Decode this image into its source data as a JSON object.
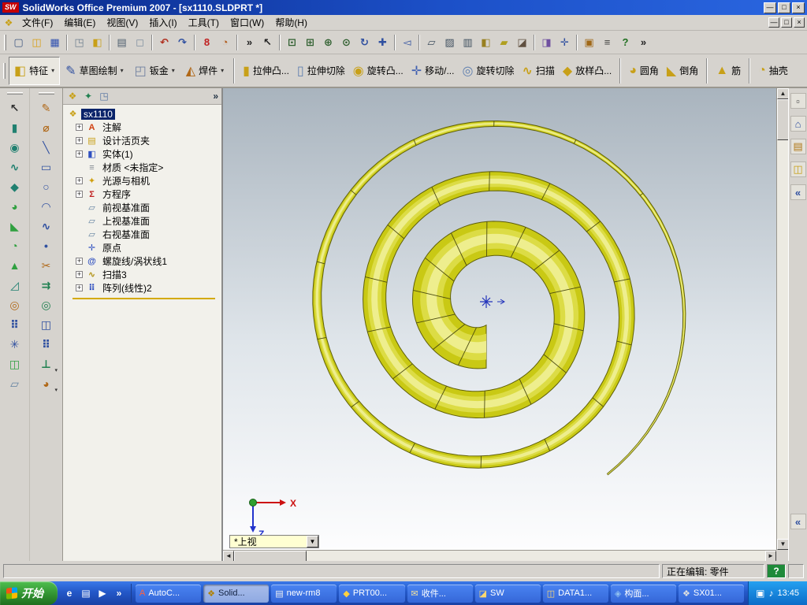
{
  "window": {
    "title": "SolidWorks Office Premium 2007 - [sx1110.SLDPRT *]",
    "logo_text": "SW",
    "controls": {
      "minimize": "—",
      "restore": "□",
      "close": "×"
    }
  },
  "menu_bar": {
    "doc_icon": {
      "name": "document-icon",
      "glyph": "❖",
      "color": "#c8a018"
    },
    "items": [
      {
        "name": "menu-file",
        "label": "文件(F)"
      },
      {
        "name": "menu-edit",
        "label": "编辑(E)"
      },
      {
        "name": "menu-view",
        "label": "视图(V)"
      },
      {
        "name": "menu-insert",
        "label": "插入(I)"
      },
      {
        "name": "menu-tools",
        "label": "工具(T)"
      },
      {
        "name": "menu-window",
        "label": "窗口(W)"
      },
      {
        "name": "menu-help",
        "label": "帮助(H)"
      }
    ],
    "controls": {
      "minimize": "—",
      "restore": "□",
      "close": "×"
    }
  },
  "standard_toolbar": {
    "icons": [
      {
        "name": "new-icon",
        "glyph": "▢",
        "color": "#405880"
      },
      {
        "name": "open-icon",
        "glyph": "◫",
        "color": "#d8a018"
      },
      {
        "name": "save-icon",
        "glyph": "▦",
        "color": "#3050b0"
      },
      {
        "sep": true
      },
      {
        "name": "make-drawing-icon",
        "glyph": "◳",
        "color": "#708090"
      },
      {
        "name": "make-assembly-icon",
        "glyph": "◧",
        "color": "#c8a018"
      },
      {
        "sep": true
      },
      {
        "name": "print-icon",
        "glyph": "▤",
        "color": "#506070"
      },
      {
        "name": "print-preview-icon",
        "glyph": "◻",
        "color": "#8090a0"
      },
      {
        "sep": true
      },
      {
        "name": "undo-icon",
        "glyph": "↶",
        "color": "#b03020"
      },
      {
        "name": "redo-icon",
        "glyph": "↷",
        "color": "#3050a0"
      },
      {
        "sep": true
      },
      {
        "name": "rebuild-icon",
        "glyph": "8",
        "color": "#c02020"
      },
      {
        "name": "edit-color-icon",
        "glyph": "◔",
        "color": "#b05818"
      },
      {
        "sep": true
      },
      {
        "name": "toolbar-overflow-icon",
        "glyph": "»",
        "color": "#222222"
      },
      {
        "name": "select-icon",
        "glyph": "↖",
        "color": "#202020"
      },
      {
        "sep": true
      },
      {
        "name": "zoom-fit-icon",
        "glyph": "⊡",
        "color": "#306030"
      },
      {
        "name": "zoom-area-icon",
        "glyph": "⊞",
        "color": "#306030"
      },
      {
        "name": "zoom-in-out-icon",
        "glyph": "⊕",
        "color": "#306030"
      },
      {
        "name": "zoom-selection-icon",
        "glyph": "⊙",
        "color": "#306030"
      },
      {
        "name": "rotate-view-icon",
        "glyph": "↻",
        "color": "#3050a0"
      },
      {
        "name": "pan-icon",
        "glyph": "✚",
        "color": "#3050a0"
      },
      {
        "sep": true
      },
      {
        "name": "previous-view-icon",
        "glyph": "◅",
        "color": "#3050a0"
      },
      {
        "sep": true
      },
      {
        "name": "wireframe-icon",
        "glyph": "▱",
        "color": "#405060"
      },
      {
        "name": "hidden-lines-visible-icon",
        "glyph": "▨",
        "color": "#405060"
      },
      {
        "name": "hidden-lines-removed-icon",
        "glyph": "▥",
        "color": "#405060"
      },
      {
        "name": "shaded-with-edges-icon",
        "glyph": "◧",
        "color": "#988020"
      },
      {
        "name": "shaded-icon",
        "glyph": "▰",
        "color": "#b0a020"
      },
      {
        "name": "shadows-icon",
        "glyph": "◪",
        "color": "#605040"
      },
      {
        "sep": true
      },
      {
        "name": "section-view-icon",
        "glyph": "◨",
        "color": "#7050a0"
      },
      {
        "name": "view-orientation-icon",
        "glyph": "✛",
        "color": "#3050a0"
      },
      {
        "sep": true
      },
      {
        "name": "toolbox-icon",
        "glyph": "▣",
        "color": "#a06818"
      },
      {
        "name": "options-icon",
        "glyph": "≡",
        "color": "#404040"
      },
      {
        "name": "help-icon",
        "glyph": "?",
        "color": "#207020"
      },
      {
        "name": "toolbar-overflow-end-icon",
        "glyph": "»",
        "color": "#222222"
      }
    ]
  },
  "command_manager": {
    "tabs": [
      {
        "name": "tab-features",
        "label": "特征",
        "glyph": "◧",
        "color": "#c8a018",
        "active": true
      },
      {
        "name": "tab-sketch",
        "label": "草图绘制",
        "glyph": "✎",
        "color": "#3050a0"
      },
      {
        "name": "tab-sheet-metal",
        "label": "钣金",
        "glyph": "◰",
        "color": "#7080a0"
      },
      {
        "name": "tab-weldments",
        "label": "焊件",
        "glyph": "◭",
        "color": "#b06818"
      }
    ],
    "buttons": [
      {
        "name": "extrude-boss-button",
        "label": "拉伸凸...",
        "glyph": "▮",
        "color": "#c8a018"
      },
      {
        "name": "extrude-cut-button",
        "label": "拉伸切除",
        "glyph": "▯",
        "color": "#6080b0"
      },
      {
        "name": "revolve-boss-button",
        "label": "旋转凸...",
        "glyph": "◉",
        "color": "#c8a018"
      },
      {
        "name": "move-button",
        "label": "移动/...",
        "glyph": "✛",
        "color": "#4060b0"
      },
      {
        "name": "revolve-cut-button",
        "label": "旋转切除",
        "glyph": "◎",
        "color": "#6080b0"
      },
      {
        "name": "sweep-button",
        "label": "扫描",
        "glyph": "∿",
        "color": "#c8a018"
      },
      {
        "name": "loft-button",
        "label": "放样凸...",
        "glyph": "◆",
        "color": "#c8a018"
      },
      {
        "sep": true
      },
      {
        "name": "fillet-button",
        "label": "圆角",
        "glyph": "◕",
        "color": "#c8a018"
      },
      {
        "name": "chamfer-button",
        "label": "倒角",
        "glyph": "◣",
        "color": "#c8a018"
      },
      {
        "sep": true
      },
      {
        "name": "rib-button",
        "label": "筋",
        "glyph": "▲",
        "color": "#c8a018"
      },
      {
        "sep": true
      },
      {
        "name": "shell-button",
        "label": "抽壳",
        "glyph": "◔",
        "color": "#c8a018"
      }
    ]
  },
  "left_toolbar_1": {
    "icons": [
      {
        "name": "select-tool-icon",
        "glyph": "↖",
        "color": "#303030"
      },
      {
        "name": "extrude-tool-icon",
        "glyph": "▮",
        "color": "#208070"
      },
      {
        "name": "revolve-tool-icon",
        "glyph": "◉",
        "color": "#208070"
      },
      {
        "name": "sweep-tool-icon",
        "glyph": "∿",
        "color": "#208070"
      },
      {
        "name": "loft-tool-icon",
        "glyph": "◆",
        "color": "#208070"
      },
      {
        "name": "fillet-tool-icon",
        "glyph": "◕",
        "color": "#30a040"
      },
      {
        "name": "chamfer-tool-icon",
        "glyph": "◣",
        "color": "#30a040"
      },
      {
        "name": "shell-tool-icon",
        "glyph": "◔",
        "color": "#30a040"
      },
      {
        "name": "rib-tool-icon",
        "glyph": "▲",
        "color": "#30a040"
      },
      {
        "name": "draft-tool-icon",
        "glyph": "◿",
        "color": "#208070"
      },
      {
        "name": "hole-wizard-tool-icon",
        "glyph": "◎",
        "color": "#b06818"
      },
      {
        "name": "linear-pattern-tool-icon",
        "glyph": "⠿",
        "color": "#3050a0"
      },
      {
        "name": "circular-pattern-tool-icon",
        "glyph": "✳",
        "color": "#3050a0"
      },
      {
        "name": "mirror-tool-icon",
        "glyph": "◫",
        "color": "#30a040"
      },
      {
        "name": "reference-plane-tool-icon",
        "glyph": "▱",
        "color": "#6080a0"
      }
    ]
  },
  "left_toolbar_2": {
    "icons": [
      {
        "name": "sketch-tool-icon",
        "glyph": "✎",
        "color": "#b06818"
      },
      {
        "name": "smart-dimension-tool-icon",
        "glyph": "⌀",
        "color": "#b06818"
      },
      {
        "name": "line-tool-icon",
        "glyph": "╲",
        "color": "#3050a0"
      },
      {
        "name": "rectangle-tool-icon",
        "glyph": "▭",
        "color": "#3050a0"
      },
      {
        "name": "circle-tool-icon",
        "glyph": "○",
        "color": "#3050a0"
      },
      {
        "name": "arc-tool-icon",
        "glyph": "◠",
        "color": "#3050a0"
      },
      {
        "name": "spline-tool-icon",
        "glyph": "∿",
        "color": "#3050a0"
      },
      {
        "name": "point-tool-icon",
        "glyph": "•",
        "color": "#3050a0"
      },
      {
        "name": "trim-tool-icon",
        "glyph": "✂",
        "color": "#b06818"
      },
      {
        "name": "convert-entities-tool-icon",
        "glyph": "⇉",
        "color": "#208050"
      },
      {
        "name": "offset-entities-tool-icon",
        "glyph": "◎",
        "color": "#208050"
      },
      {
        "name": "mirror-entities-tool-icon",
        "glyph": "◫",
        "color": "#3050a0"
      },
      {
        "name": "sketch-pattern-tool-icon",
        "glyph": "⠿",
        "color": "#3050a0"
      },
      {
        "name": "add-relation-tool-icon",
        "glyph": "⊥",
        "color": "#208050",
        "flyout": true
      },
      {
        "name": "sketch-fillet-tool-icon",
        "glyph": "◕",
        "color": "#b06818",
        "flyout": true
      }
    ]
  },
  "feature_tree": {
    "header_icons": [
      {
        "name": "featuremanager-tab-icon",
        "glyph": "❖",
        "color": "#c8a018"
      },
      {
        "name": "propertymanager-tab-icon",
        "glyph": "✦",
        "color": "#208050"
      },
      {
        "name": "configurationmanager-tab-icon",
        "glyph": "◳",
        "color": "#5070a0"
      }
    ],
    "overflow_glyph": "»",
    "items": [
      {
        "name": "tree-item-root",
        "label": "sx1110",
        "glyph": "❖",
        "color": "#c8a018",
        "selected": true,
        "root": true
      },
      {
        "name": "tree-item-annotations",
        "label": "注解",
        "glyph": "A",
        "color": "#d04010",
        "expand": true
      },
      {
        "name": "tree-item-design-binder",
        "label": "设计活页夹",
        "glyph": "▤",
        "color": "#c8a018",
        "expand": true
      },
      {
        "name": "tree-item-solid-bodies",
        "label": "实体(1)",
        "glyph": "◧",
        "color": "#3050c0",
        "expand": true
      },
      {
        "name": "tree-item-material",
        "label": "材质 <未指定>",
        "glyph": "≡",
        "color": "#808890"
      },
      {
        "name": "tree-item-lights-cameras",
        "label": "光源与相机",
        "glyph": "✦",
        "color": "#d0a010",
        "expand": true
      },
      {
        "name": "tree-item-equations",
        "label": "方程序",
        "glyph": "Σ",
        "color": "#c02020",
        "expand": true
      },
      {
        "name": "tree-item-front-plane",
        "label": "前视基准面",
        "glyph": "▱",
        "color": "#6080a0"
      },
      {
        "name": "tree-item-top-plane",
        "label": "上视基准面",
        "glyph": "▱",
        "color": "#6080a0"
      },
      {
        "name": "tree-item-right-plane",
        "label": "右视基准面",
        "glyph": "▱",
        "color": "#6080a0"
      },
      {
        "name": "tree-item-origin",
        "label": "原点",
        "glyph": "✛",
        "color": "#3050c0"
      },
      {
        "name": "tree-item-helix",
        "label": "螺旋线/涡状线1",
        "glyph": "@",
        "color": "#3050c0",
        "expand": true
      },
      {
        "name": "tree-item-sweep3",
        "label": "扫描3",
        "glyph": "∿",
        "color": "#b09010",
        "expand": true
      },
      {
        "name": "tree-item-linear-pattern2",
        "label": "阵列(线性)2",
        "glyph": "⠿",
        "color": "#3050c0",
        "expand": true
      }
    ]
  },
  "viewport": {
    "view_combo": {
      "value": "*上视"
    },
    "triad": {
      "x_label": "X",
      "z_label": "Z"
    },
    "model_color": "#c9c914"
  },
  "task_pane": {
    "icons": [
      {
        "name": "task-pane-pin-icon",
        "glyph": "▫",
        "color": "#404040"
      },
      {
        "name": "solidworks-resources-icon",
        "glyph": "⌂",
        "color": "#3050a0"
      },
      {
        "name": "design-library-icon",
        "glyph": "▤",
        "color": "#b07818"
      },
      {
        "name": "file-explorer-icon",
        "glyph": "◫",
        "color": "#c8a018"
      },
      {
        "name": "collapse-task-pane-icon",
        "glyph": "«",
        "color": "#3050a0"
      }
    ],
    "bottom_icons": [
      {
        "name": "collapse-task-pane-bottom-icon",
        "glyph": "«",
        "color": "#3050a0"
      }
    ]
  },
  "status_bar": {
    "editing_label": "正在编辑: 零件",
    "help_glyph": "?"
  },
  "taskbar": {
    "start_label": "开始",
    "quick_launch": [
      {
        "name": "internet-explorer-icon",
        "glyph": "e",
        "color": "#ffffff"
      },
      {
        "name": "show-desktop-icon",
        "glyph": "▤",
        "color": "#ffffff"
      },
      {
        "name": "media-player-icon",
        "glyph": "▶",
        "color": "#ffffff"
      },
      {
        "name": "quick-launch-overflow-icon",
        "glyph": "»",
        "color": "#ffffff"
      }
    ],
    "tasks": [
      {
        "name": "task-autocad",
        "label": "AutoC...",
        "glyph": "A",
        "color": "#ff6040"
      },
      {
        "name": "task-solidworks",
        "label": "Solid...",
        "glyph": "❖",
        "color": "#b08000",
        "active": true
      },
      {
        "name": "task-new-rm8",
        "label": "new-rm8",
        "glyph": "▤",
        "color": "#f0f0f0"
      },
      {
        "name": "task-prt00",
        "label": "PRT00...",
        "glyph": "◆",
        "color": "#ffd040"
      },
      {
        "name": "task-inbox",
        "label": "收件...",
        "glyph": "✉",
        "color": "#f0e0a0"
      },
      {
        "name": "task-sw-folder",
        "label": "SW",
        "glyph": "◪",
        "color": "#ffd870"
      },
      {
        "name": "task-data1",
        "label": "DATA1...",
        "glyph": "◫",
        "color": "#ffd870"
      },
      {
        "name": "task-goumian",
        "label": "构面...",
        "glyph": "◈",
        "color": "#90c0f0"
      },
      {
        "name": "task-sx01",
        "label": "SX01...",
        "glyph": "❖",
        "color": "#e0e0e0"
      }
    ],
    "tray": {
      "icons": [
        {
          "name": "ime-icon",
          "glyph": "▣",
          "color": "#ffffff"
        },
        {
          "name": "volume-icon",
          "glyph": "♪",
          "color": "#ffffff"
        }
      ],
      "time": "13:45"
    }
  }
}
